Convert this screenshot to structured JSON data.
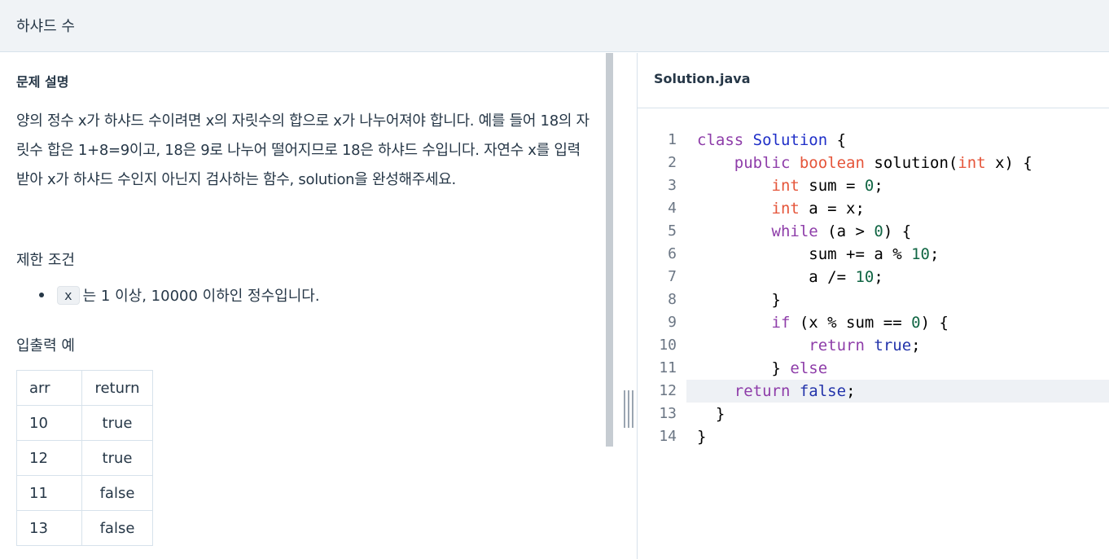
{
  "header": {
    "title": "하샤드 수"
  },
  "problem": {
    "section_title": "문제 설명",
    "description": "양의 정수 x가 하샤드 수이려면 x의 자릿수의 합으로 x가 나누어져야 합니다. 예를 들어 18의 자릿수 합은 1+8=9이고, 18은 9로 나누어 떨어지므로 18은 하샤드 수입니다. 자연수 x를 입력받아 x가 하샤드 수인지 아닌지 검사하는 함수, solution을 완성해주세요.",
    "constraints_title": "제한 조건",
    "constraint_code": "x",
    "constraint_text": "는 1 이상, 10000 이하인 정수입니다.",
    "io_title": "입출력 예",
    "table": {
      "headers": [
        "arr",
        "return"
      ],
      "rows": [
        [
          "10",
          "true"
        ],
        [
          "12",
          "true"
        ],
        [
          "11",
          "false"
        ],
        [
          "13",
          "false"
        ]
      ]
    }
  },
  "editor": {
    "file_name": "Solution.java",
    "active_line": 12,
    "lines": [
      {
        "n": "1",
        "tokens": [
          [
            "kw",
            "class"
          ],
          [
            "",
            "",
            " "
          ],
          [
            "cls",
            "Solution"
          ],
          [
            "",
            " {"
          ]
        ]
      },
      {
        "n": "2",
        "tokens": [
          [
            "",
            "    "
          ],
          [
            "kw",
            "public"
          ],
          [
            "",
            " "
          ],
          [
            "ty",
            "boolean"
          ],
          [
            "",
            " solution("
          ],
          [
            "ty",
            "int"
          ],
          [
            "",
            " x) {"
          ]
        ]
      },
      {
        "n": "3",
        "tokens": [
          [
            "",
            "        "
          ],
          [
            "ty",
            "int"
          ],
          [
            "",
            " sum = "
          ],
          [
            "num",
            "0"
          ],
          [
            "",
            ";"
          ]
        ]
      },
      {
        "n": "4",
        "tokens": [
          [
            "",
            "        "
          ],
          [
            "ty",
            "int"
          ],
          [
            "",
            " a = x;"
          ]
        ]
      },
      {
        "n": "5",
        "tokens": [
          [
            "",
            "        "
          ],
          [
            "kw",
            "while"
          ],
          [
            "",
            " (a > "
          ],
          [
            "num",
            "0"
          ],
          [
            "",
            ") {"
          ]
        ]
      },
      {
        "n": "6",
        "tokens": [
          [
            "",
            "            sum += a % "
          ],
          [
            "num",
            "10"
          ],
          [
            "",
            ";"
          ]
        ]
      },
      {
        "n": "7",
        "tokens": [
          [
            "",
            "            a /= "
          ],
          [
            "num",
            "10"
          ],
          [
            "",
            ";"
          ]
        ]
      },
      {
        "n": "8",
        "tokens": [
          [
            "",
            "        }"
          ]
        ]
      },
      {
        "n": "9",
        "tokens": [
          [
            "",
            "        "
          ],
          [
            "kw",
            "if"
          ],
          [
            "",
            " (x % sum == "
          ],
          [
            "num",
            "0"
          ],
          [
            "",
            ") {"
          ]
        ]
      },
      {
        "n": "10",
        "tokens": [
          [
            "",
            "            "
          ],
          [
            "kw",
            "return"
          ],
          [
            "",
            " "
          ],
          [
            "lit",
            "true"
          ],
          [
            "",
            ";"
          ]
        ]
      },
      {
        "n": "11",
        "tokens": [
          [
            "",
            "        } "
          ],
          [
            "kw",
            "else"
          ]
        ]
      },
      {
        "n": "12",
        "tokens": [
          [
            "",
            "    "
          ],
          [
            "kw",
            "return"
          ],
          [
            "",
            " "
          ],
          [
            "lit",
            "false"
          ],
          [
            "",
            ";"
          ]
        ]
      },
      {
        "n": "13",
        "tokens": [
          [
            "",
            "  }"
          ]
        ]
      },
      {
        "n": "14",
        "tokens": [
          [
            "",
            "}"
          ]
        ]
      }
    ]
  },
  "colors": {
    "header_bg": "#f0f3f6",
    "keyword": "#8e3da9",
    "type": "#e5553a",
    "class_name": "#1f2fc8",
    "number": "#116644",
    "literal": "#2233aa",
    "active_line_bg": "#eef1f5"
  }
}
